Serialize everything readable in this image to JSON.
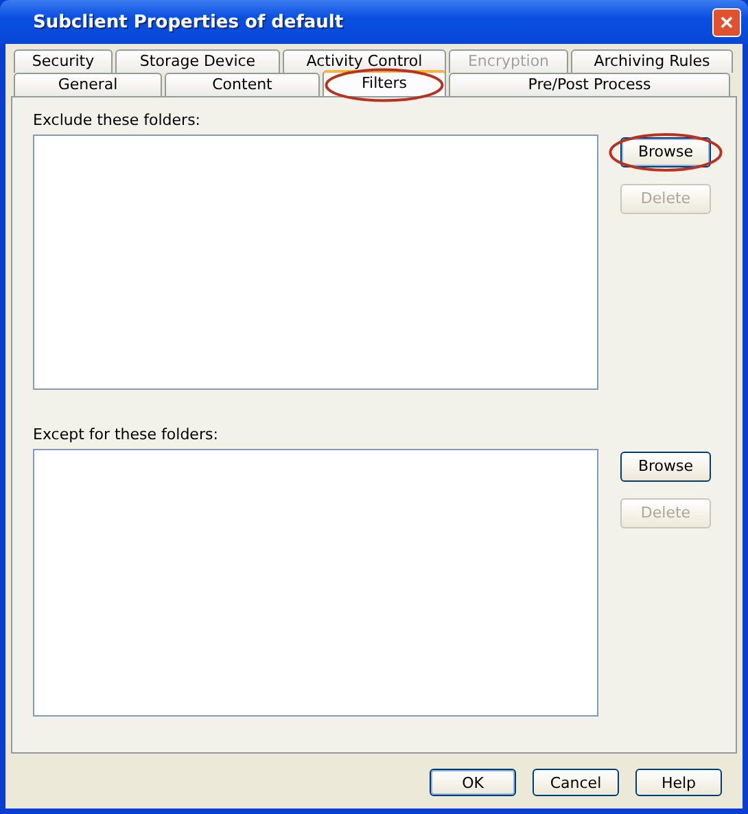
{
  "window": {
    "title": "Subclient Properties of default",
    "close": "✕"
  },
  "tab_rows": [
    [
      {
        "label": "Security",
        "selected": false,
        "disabled": false
      },
      {
        "label": "Storage Device",
        "selected": false,
        "disabled": false
      },
      {
        "label": "Activity Control",
        "selected": false,
        "disabled": false
      },
      {
        "label": "Encryption",
        "selected": false,
        "disabled": true
      },
      {
        "label": "Archiving Rules",
        "selected": false,
        "disabled": false
      }
    ],
    [
      {
        "label": "General",
        "selected": false,
        "disabled": false
      },
      {
        "label": "Content",
        "selected": false,
        "disabled": false
      },
      {
        "label": "Filters",
        "selected": true,
        "disabled": false,
        "highlighted": true
      },
      {
        "label": "Pre/Post Process",
        "selected": false,
        "disabled": false
      }
    ]
  ],
  "sections": [
    {
      "label": "Exclude these folders:",
      "buttons": [
        {
          "label": "Browse",
          "disabled": false,
          "highlighted": true
        },
        {
          "label": "Delete",
          "disabled": true,
          "highlighted": false
        }
      ]
    },
    {
      "label": "Except for these folders:",
      "buttons": [
        {
          "label": "Browse",
          "disabled": false,
          "highlighted": false
        },
        {
          "label": "Delete",
          "disabled": true,
          "highlighted": false
        }
      ]
    }
  ],
  "buttons": [
    {
      "label": "OK",
      "default": true
    },
    {
      "label": "Cancel",
      "default": false
    },
    {
      "label": "Help",
      "default": false
    }
  ]
}
